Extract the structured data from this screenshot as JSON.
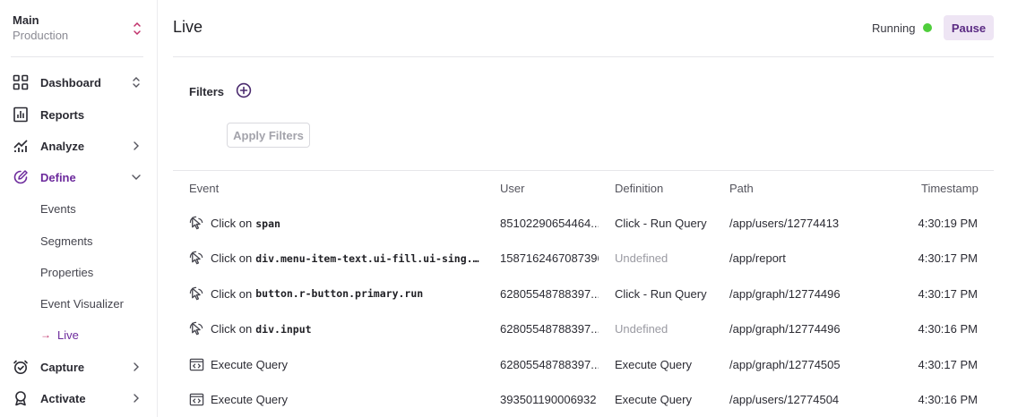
{
  "environment": {
    "name": "Main",
    "stage": "Production"
  },
  "nav": {
    "dashboard": "Dashboard",
    "reports": "Reports",
    "analyze": "Analyze",
    "define": "Define",
    "define_sub": [
      "Events",
      "Segments",
      "Properties",
      "Event Visualizer",
      "Live"
    ],
    "capture": "Capture",
    "activate": "Activate"
  },
  "header": {
    "title": "Live",
    "status": "Running",
    "status_color": "#4fce3c",
    "pause_label": "Pause"
  },
  "filters": {
    "label": "Filters",
    "apply_label": "Apply Filters"
  },
  "table": {
    "columns": {
      "event": "Event",
      "user": "User",
      "definition": "Definition",
      "path": "Path",
      "timestamp": "Timestamp"
    },
    "rows": [
      {
        "icon": "cursor-click-icon",
        "prefix": "Click on",
        "selector": "span",
        "user": "85102290654464...",
        "definition": "Click - Run Query",
        "path": "/app/users/12774413",
        "timestamp": "4:30:19 PM"
      },
      {
        "icon": "cursor-click-icon",
        "prefix": "Click on",
        "selector": "div.menu-item-text.ui-fill.ui-sing...",
        "user": "1587162467087396",
        "definition": "Undefined",
        "path": "/app/report",
        "timestamp": "4:30:17 PM"
      },
      {
        "icon": "cursor-click-icon",
        "prefix": "Click on",
        "selector": "button.r-button.primary.run",
        "user": "62805548788397...",
        "definition": "Click - Run Query",
        "path": "/app/graph/12774496",
        "timestamp": "4:30:17 PM"
      },
      {
        "icon": "cursor-click-icon",
        "prefix": "Click on",
        "selector": "div.input",
        "user": "62805548788397...",
        "definition": "Undefined",
        "path": "/app/graph/12774496",
        "timestamp": "4:30:16 PM"
      },
      {
        "icon": "code-window-icon",
        "prefix": "Execute Query",
        "selector": "",
        "user": "62805548788397...",
        "definition": "Execute Query",
        "path": "/app/graph/12774505",
        "timestamp": "4:30:17 PM"
      },
      {
        "icon": "code-window-icon",
        "prefix": "Execute Query",
        "selector": "",
        "user": "393501190006932",
        "definition": "Execute Query",
        "path": "/app/users/12774504",
        "timestamp": "4:30:16 PM"
      }
    ]
  },
  "colors": {
    "accent": "#6c2a9c",
    "arrow": "#c0306a",
    "pause_bg": "#eee5f4"
  }
}
